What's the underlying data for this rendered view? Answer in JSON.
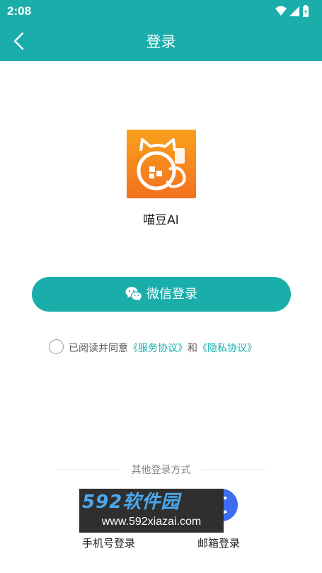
{
  "status_bar": {
    "time": "2:08",
    "icons": [
      "wifi-icon",
      "cellular-icon",
      "battery-icon"
    ]
  },
  "app_bar": {
    "title": "登录",
    "back_icon": "chevron-left-icon"
  },
  "brand": {
    "app_name": "喵豆AI",
    "logo_icon": "cat-logo-icon"
  },
  "wechat_login": {
    "label": "微信登录",
    "icon": "wechat-icon"
  },
  "agreement": {
    "prefix": "已阅读并同意",
    "service_link": "《服务协议》",
    "conjunction": "和",
    "privacy_link": "《隐私协议》"
  },
  "other_methods": {
    "title": "其他登录方式",
    "phone_label": "手机号登录",
    "email_label": "邮箱登录"
  },
  "watermark": {
    "line1": "592软件园",
    "line2": "www.592xiazai.com"
  },
  "colors": {
    "primary": "#1aaeaa",
    "link": "#1aaeaa",
    "logo_orange": "#f7931e"
  }
}
